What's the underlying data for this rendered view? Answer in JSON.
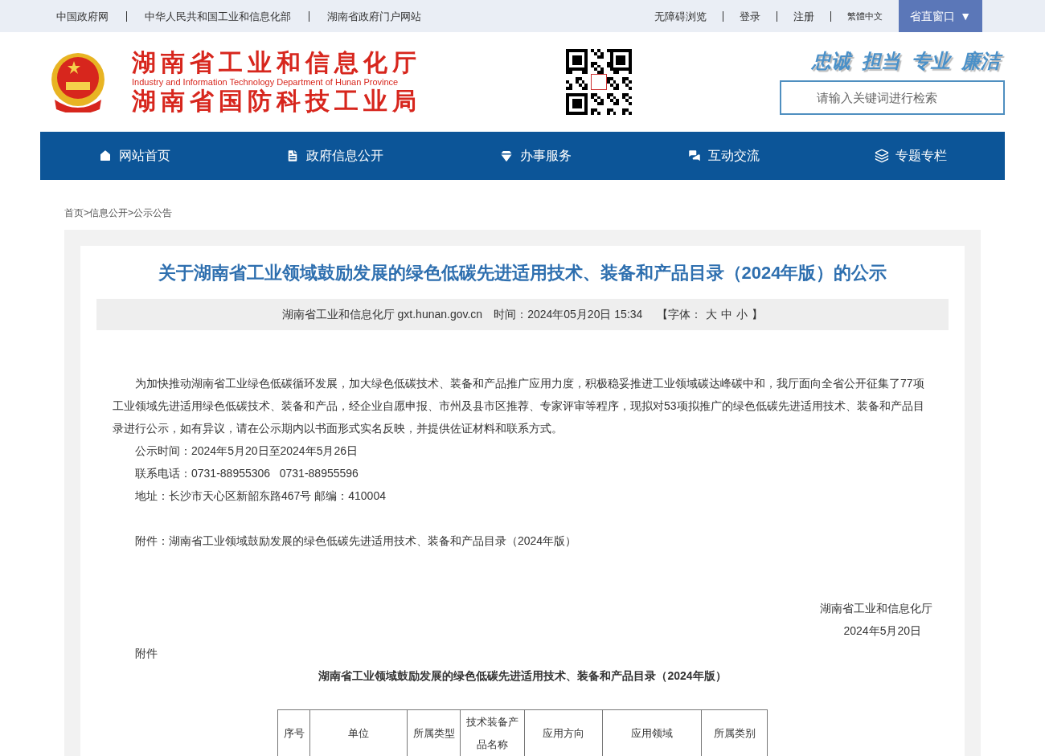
{
  "top_bar": {
    "left_links": [
      "中国政府网",
      "中华人民共和国工业和信息化部",
      "湖南省政府门户网站"
    ],
    "right_links": [
      "无障碍浏览",
      "登录",
      "注册",
      "繁體中文"
    ],
    "menu_button": {
      "label": "省直窗口",
      "caret": "▼"
    }
  },
  "header": {
    "title_cn": "湖南省工业和信息化厅",
    "title_en": "Industry and Information Technology Department of Hunan Province",
    "title_cn2": "湖南省国防科技工业局",
    "slogan": [
      "忠诚",
      "担当",
      "专业",
      "廉洁"
    ],
    "search": {
      "placeholder": "请输入关键词进行检索"
    }
  },
  "nav": [
    {
      "label": "网站首页",
      "kind": "home"
    },
    {
      "label": "政府信息公开",
      "kind": "doc"
    },
    {
      "label": "办事服务",
      "kind": "service"
    },
    {
      "label": "互动交流",
      "kind": "chat"
    },
    {
      "label": "专题专栏",
      "kind": "layers"
    }
  ],
  "breadcrumb": [
    "首页",
    ">",
    "信息公开",
    ">",
    "公示公告"
  ],
  "article": {
    "title": "关于湖南省工业领域鼓励发展的绿色低碳先进适用技术、装备和产品目录（2024年版）的公示",
    "meta": {
      "source": "湖南省工业和信息化厅 gxt.hunan.gov.cn",
      "time": "时间：2024年05月20日 15:34",
      "font_label": "【字体：",
      "sizes": [
        "大",
        "中",
        "小"
      ],
      "font_end": "】"
    },
    "paragraphs": [
      {
        "kind": "text",
        "text": "为加快推动湖南省工业绿色低碳循环发展，加大绿色低碳技术、装备和产品推广应用力度，积极稳妥推进工业领域碳达峰碳中和，我厅面向全省公开征集了77项工业领域先进适用绿色低碳技术、装备和产品，经企业自愿申报、市州及县市区推荐、专家评审等程序，现拟对53项拟推广的绿色低碳先进适用技术、装备和产品目录进行公示，如有异议，请在公示期内以书面形式实名反映，并提供佐证材料和联系方式。"
      },
      {
        "kind": "text",
        "text": "公示时间：2024年5月20日至2024年5月26日"
      },
      {
        "kind": "text",
        "text": "联系电话：0731-88955306   0731-88955596"
      },
      {
        "kind": "text",
        "text": "地址：长沙市天心区新韶东路467号 邮编：410004"
      },
      {
        "kind": "gap"
      },
      {
        "kind": "attachment",
        "text": "附件：湖南省工业领域鼓励发展的绿色低碳先进适用技术、装备和产品目录（2024年版）"
      },
      {
        "kind": "gap"
      },
      {
        "kind": "gap"
      },
      {
        "kind": "signature",
        "text": "湖南省工业和信息化厅"
      },
      {
        "kind": "date",
        "text": "2024年5月20日"
      },
      {
        "kind": "text",
        "text": "附件"
      },
      {
        "kind": "heading",
        "text": "湖南省工业领域鼓励发展的绿色低碳先进适用技术、装备和产品目录（2024年版）"
      }
    ],
    "table": {
      "columns": [
        "序号",
        "单位",
        "所属类型",
        "技术装备产品名称",
        "应用方向",
        "应用领域",
        "所属类别"
      ]
    }
  }
}
